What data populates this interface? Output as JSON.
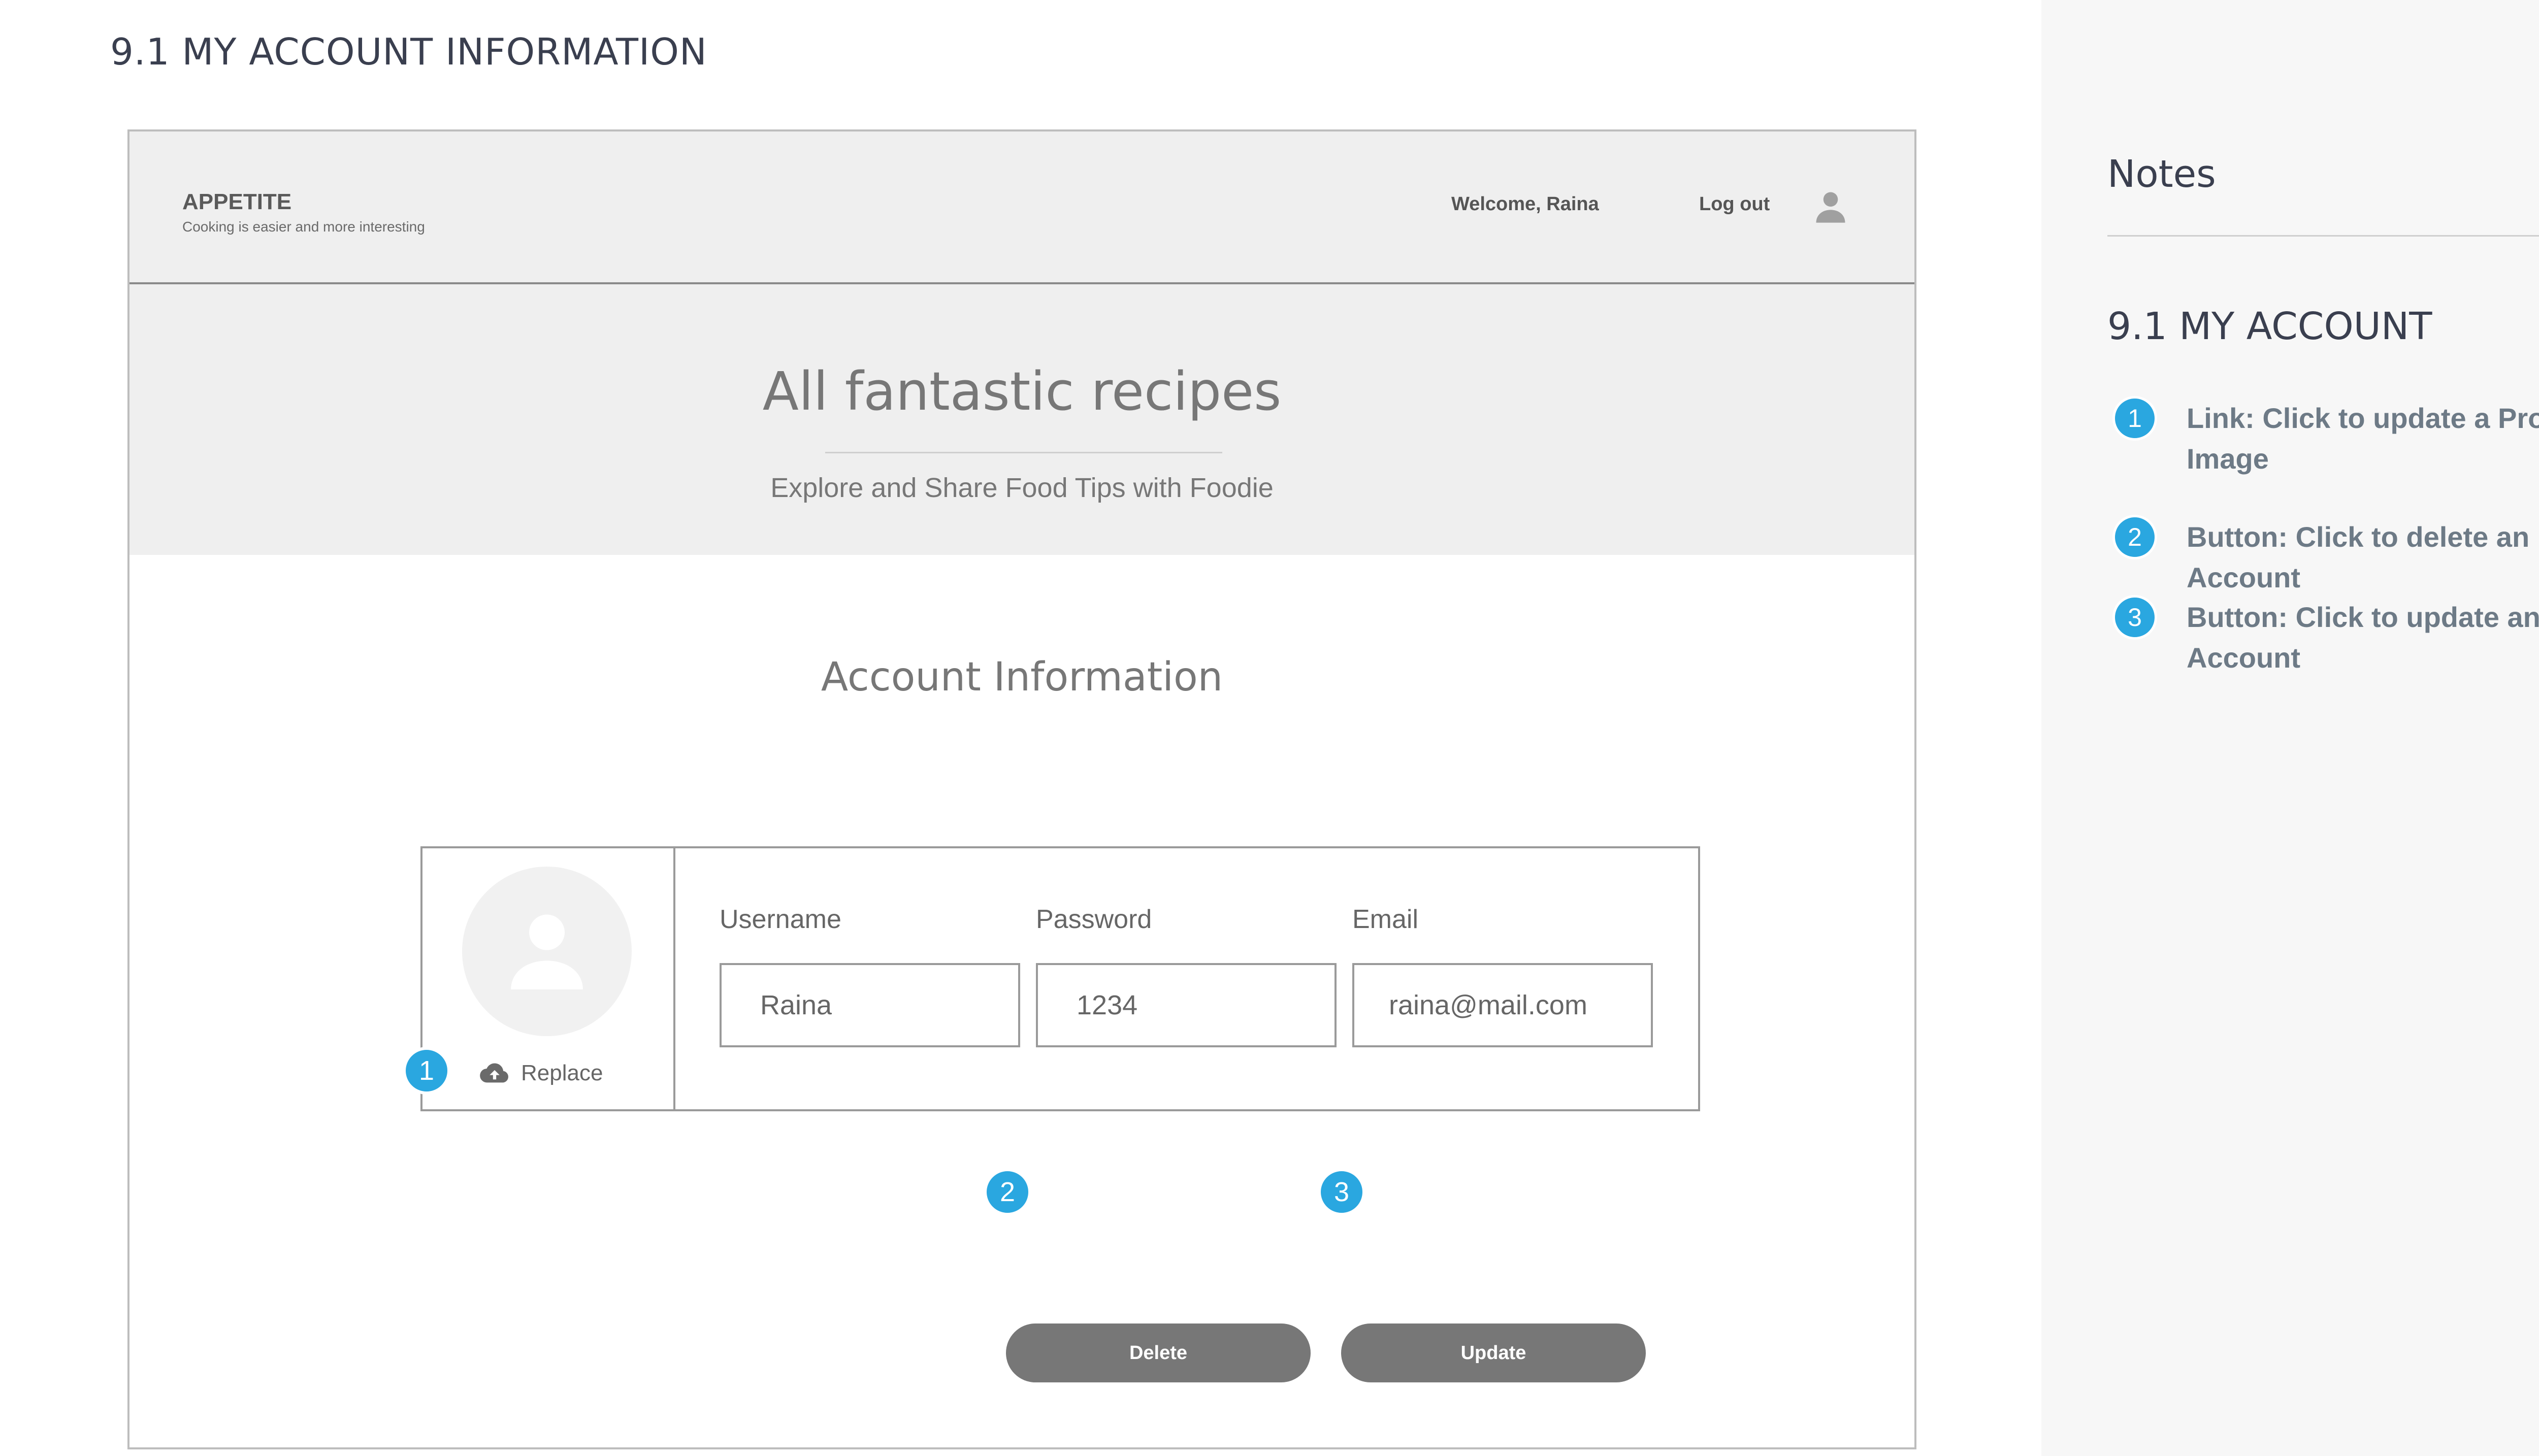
{
  "page_title": "9.1  MY ACCOUNT INFORMATION",
  "colors": {
    "badge": "#2aa7e0",
    "button": "#777777",
    "bar_background": "#efefef",
    "notes_panel": "#f7f7f7"
  },
  "header": {
    "brand_name": "APPETITE",
    "brand_tagline": "Cooking is easier and more interesting",
    "welcome": "Welcome, Raina",
    "logout": "Log out",
    "user_icon": "user-icon"
  },
  "hero": {
    "title": "All fantastic recipes",
    "subtitle": "Explore and Share Food Tips with Foodie"
  },
  "account": {
    "section_title": "Account Information",
    "replace_label": "Replace",
    "replace_icon": "cloud-upload-icon",
    "fields": [
      {
        "label": "Username",
        "value": "Raina"
      },
      {
        "label": "Password",
        "value": "1234"
      },
      {
        "label": "Email",
        "value": "raina@mail.com"
      }
    ],
    "delete_label": "Delete",
    "update_label": "Update"
  },
  "badges": {
    "one": "1",
    "two": "2",
    "three": "3"
  },
  "notes": {
    "title": "Notes",
    "section": "9.1 MY ACCOUNT",
    "items": [
      {
        "num": "1",
        "text": "Link: Click to update a Profile Image"
      },
      {
        "num": "2",
        "text": "Button: Click to delete an Account"
      },
      {
        "num": "3",
        "text": "Button: Click to update an Account"
      }
    ]
  }
}
